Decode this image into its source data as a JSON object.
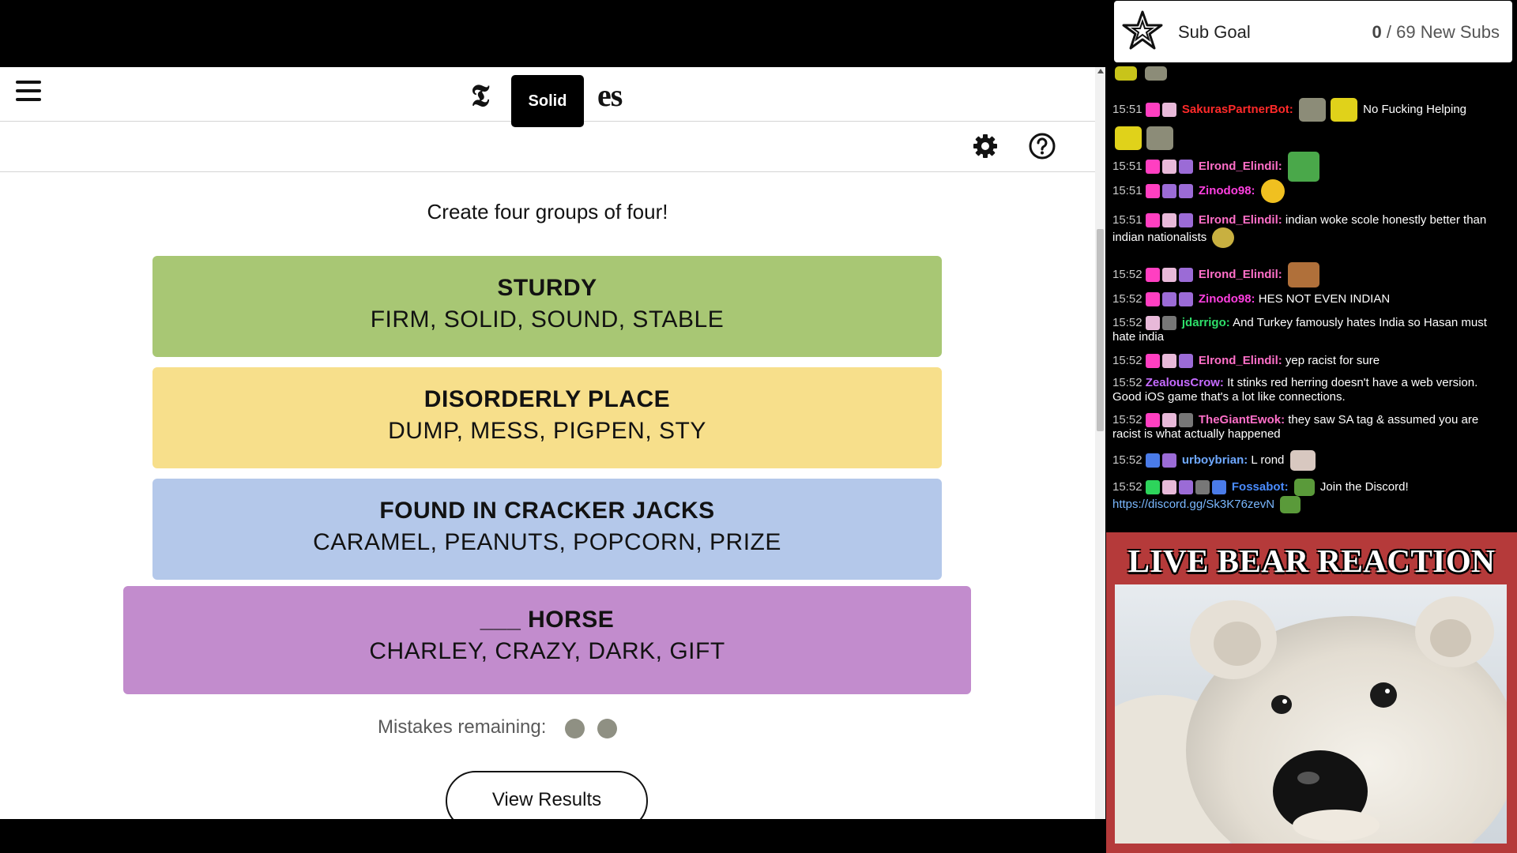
{
  "game": {
    "tooltip": "Solid",
    "logo_letter": "𝕿",
    "logo_tail": "es",
    "instructions": "Create four groups of four!",
    "groups": [
      {
        "category": "STURDY",
        "words": "FIRM, SOLID, SOUND, STABLE",
        "color": "#a8c774"
      },
      {
        "category": "DISORDERLY PLACE",
        "words": "DUMP, MESS, PIGPEN, STY",
        "color": "#f7df8b"
      },
      {
        "category": "FOUND IN CRACKER JACKS",
        "words": "CARAMEL, PEANUTS, POPCORN, PRIZE",
        "color": "#b4c8ea"
      },
      {
        "category": "___ HORSE",
        "words": "CHARLEY, CRAZY, DARK, GIFT",
        "color": "#c28ccd"
      }
    ],
    "mistakes_label": "Mistakes remaining:",
    "mistakes_remaining": 2,
    "view_results_label": "View Results"
  },
  "subgoal": {
    "label": "Sub Goal",
    "current": "0",
    "total": "/ 69 New Subs"
  },
  "chat": {
    "messages": [
      {
        "time": "15:51",
        "user": "SakurasPartnerBot:",
        "user_color": "#ff2a2a",
        "text": "No Fucking Helping"
      },
      {
        "time": "15:51",
        "user": "Elrond_Elindil:",
        "user_color": "#ff6fc8",
        "text": ""
      },
      {
        "time": "15:51",
        "user": "Zinodo98:",
        "user_color": "#ff3fe0",
        "text": ""
      },
      {
        "time": "15:51",
        "user": "Elrond_Elindil:",
        "user_color": "#ff6fc8",
        "text": "indian woke scole honestly better than",
        "text2": "indian nationalists"
      },
      {
        "time": "15:52",
        "user": "Elrond_Elindil:",
        "user_color": "#ff6fc8",
        "text": ""
      },
      {
        "time": "15:52",
        "user": "Zinodo98:",
        "user_color": "#ff3fe0",
        "text": "HES NOT EVEN INDIAN"
      },
      {
        "time": "15:52",
        "user": "jdarrigo:",
        "user_color": "#2ee06a",
        "text": "And Turkey famously hates India so Hasan must",
        "text2": "hate india"
      },
      {
        "time": "15:52",
        "user": "Elrond_Elindil:",
        "user_color": "#ff6fc8",
        "text": "yep racist for sure"
      },
      {
        "time": "15:52",
        "user": "ZealousCrow:",
        "user_color": "#c66bff",
        "text": "It stinks red herring doesn't have a web version.",
        "text2": "Good iOS game that's a lot like connections."
      },
      {
        "time": "15:52",
        "user": "TheGiantEwok:",
        "user_color": "#ff6fc8",
        "text": "they saw SA tag & assumed you are",
        "text2": "racist is what actually happened"
      },
      {
        "time": "15:52",
        "user": "urboybrian:",
        "user_color": "#6ea8ff",
        "text": "L rond"
      },
      {
        "time": "15:52",
        "user": "Fossabot:",
        "user_color": "#4a8cff",
        "text": "Join the Discord!",
        "link": "https://discord.gg/Sk3K76zevN"
      }
    ]
  },
  "bear": {
    "title": "LIVE BEAR REACTION"
  },
  "colors": {
    "mistake_dot": "#8f9083",
    "panel_red": "#b53a3a"
  }
}
